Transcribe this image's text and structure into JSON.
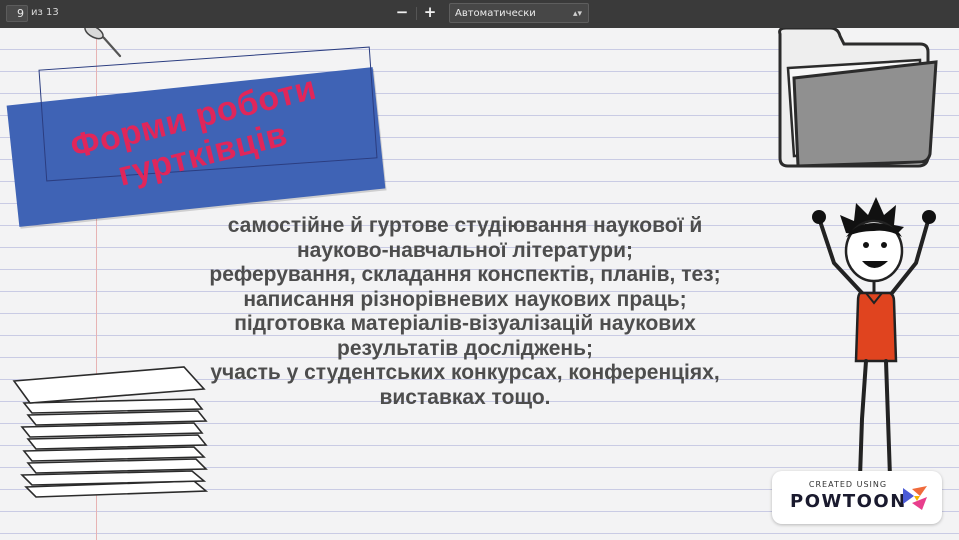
{
  "toolbar": {
    "page_number": "9",
    "page_total": "из 13",
    "zoom_out_label": "−",
    "zoom_in_label": "+",
    "zoom_value": "Автоматически"
  },
  "slide": {
    "title_lines": [
      "Форми роботи",
      "гуртківців"
    ],
    "content_lines": [
      "самостійне й гуртове студіювання наукової й",
      "науково-навчальної літератури;",
      "реферування, складання конспектів, планів, тез;",
      "написання різнорівневих наукових праць;",
      "підготовка матеріалів-візуалізацій наукових",
      "результатів досліджень;",
      "участь у студентських конкурсах, конференціях,",
      "виставках тощо."
    ],
    "badge_small": "CREATED USING",
    "badge_brand": "POWTOON"
  },
  "colors": {
    "title_box": "#3f63b5",
    "title_text": "#e0265a",
    "shirt": "#e0441f",
    "paper_line": "#c9cbe4"
  },
  "icons": [
    "pin-icon",
    "folder-icon",
    "paper-stack-icon",
    "character-icon",
    "powtoon-logo-icon",
    "chevron-updown-icon"
  ]
}
